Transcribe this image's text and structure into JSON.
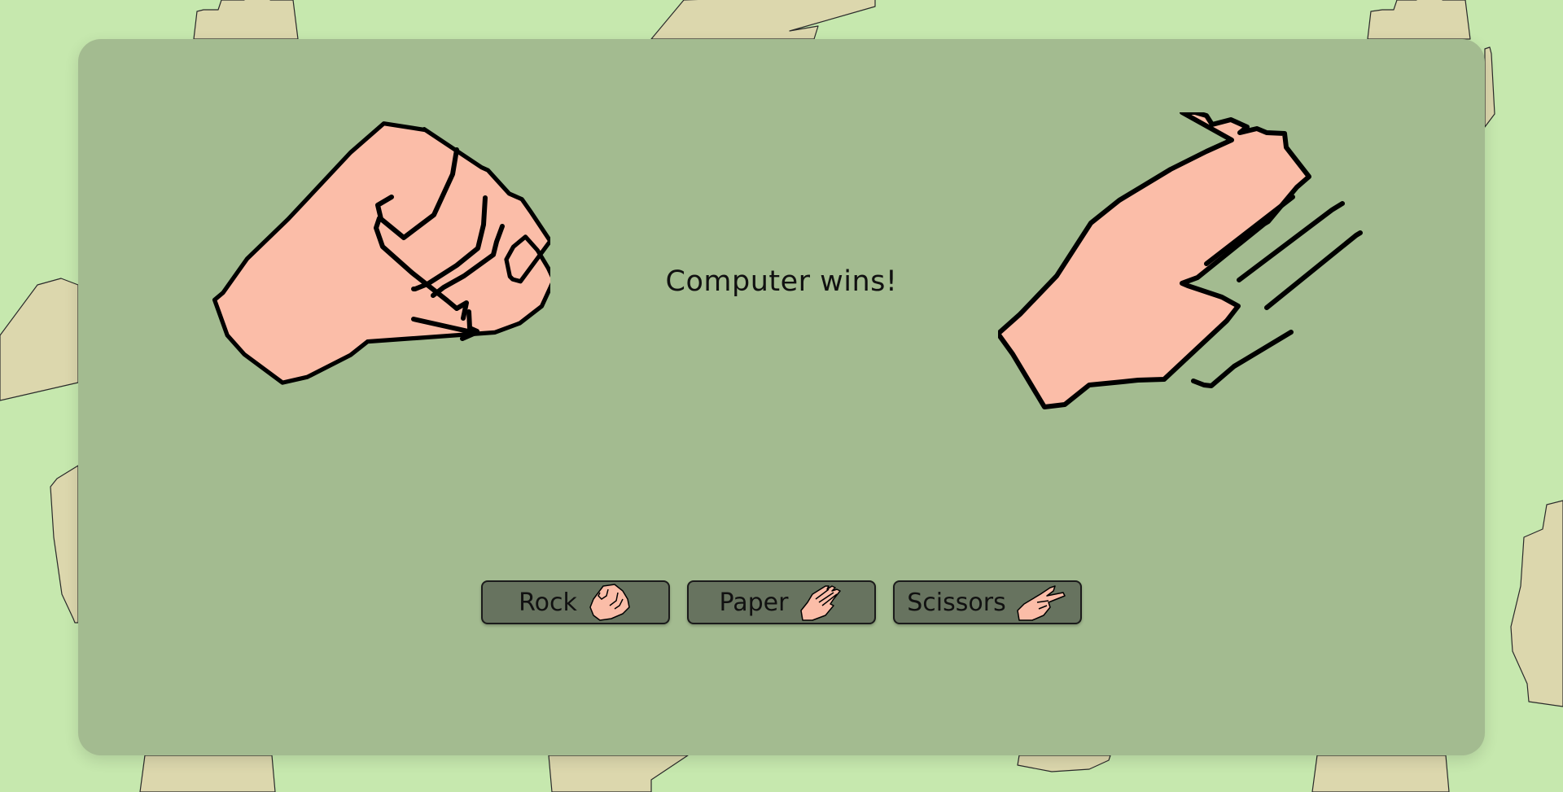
{
  "game": {
    "result_text": "Computer wins!",
    "player_hand": "rock",
    "computer_hand": "paper"
  },
  "buttons": [
    {
      "label": "Rock",
      "icon": "rock-hand-icon"
    },
    {
      "label": "Paper",
      "icon": "paper-hand-icon"
    },
    {
      "label": "Scissors",
      "icon": "scissors-hand-icon"
    }
  ],
  "colors": {
    "page_background": "#c6e8ae",
    "card_background": "#a3bb90",
    "button_background": "#67735f",
    "skin": "#fbbda8",
    "background_hand": "#dcd7ad"
  }
}
